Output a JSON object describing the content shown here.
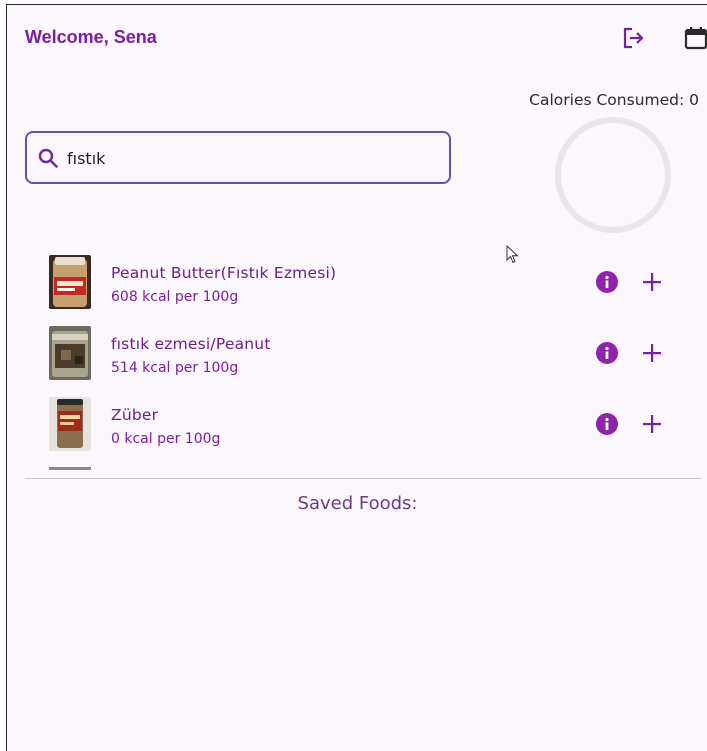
{
  "header": {
    "welcome": "Welcome, Sena",
    "logout_icon": "logout-icon",
    "calendar_icon": "calendar-icon"
  },
  "calories": {
    "label": "Calories Consumed: 0",
    "progress": 0
  },
  "search": {
    "value": "fıstık",
    "icon": "search-icon"
  },
  "foods": [
    {
      "name": "Peanut Butter(Fıstık Ezmesi)",
      "kcal": "608 kcal per 100g"
    },
    {
      "name": "fıstık ezmesi/Peanut",
      "kcal": "514 kcal per 100g"
    },
    {
      "name": "Züber",
      "kcal": "0 kcal per 100g"
    }
  ],
  "saved": {
    "title": "Saved Foods:"
  },
  "colors": {
    "accent": "#7a1fa2",
    "info_button": "#8e24aa",
    "background": "#fcf6fd",
    "search_border": "#6f4ea6"
  }
}
